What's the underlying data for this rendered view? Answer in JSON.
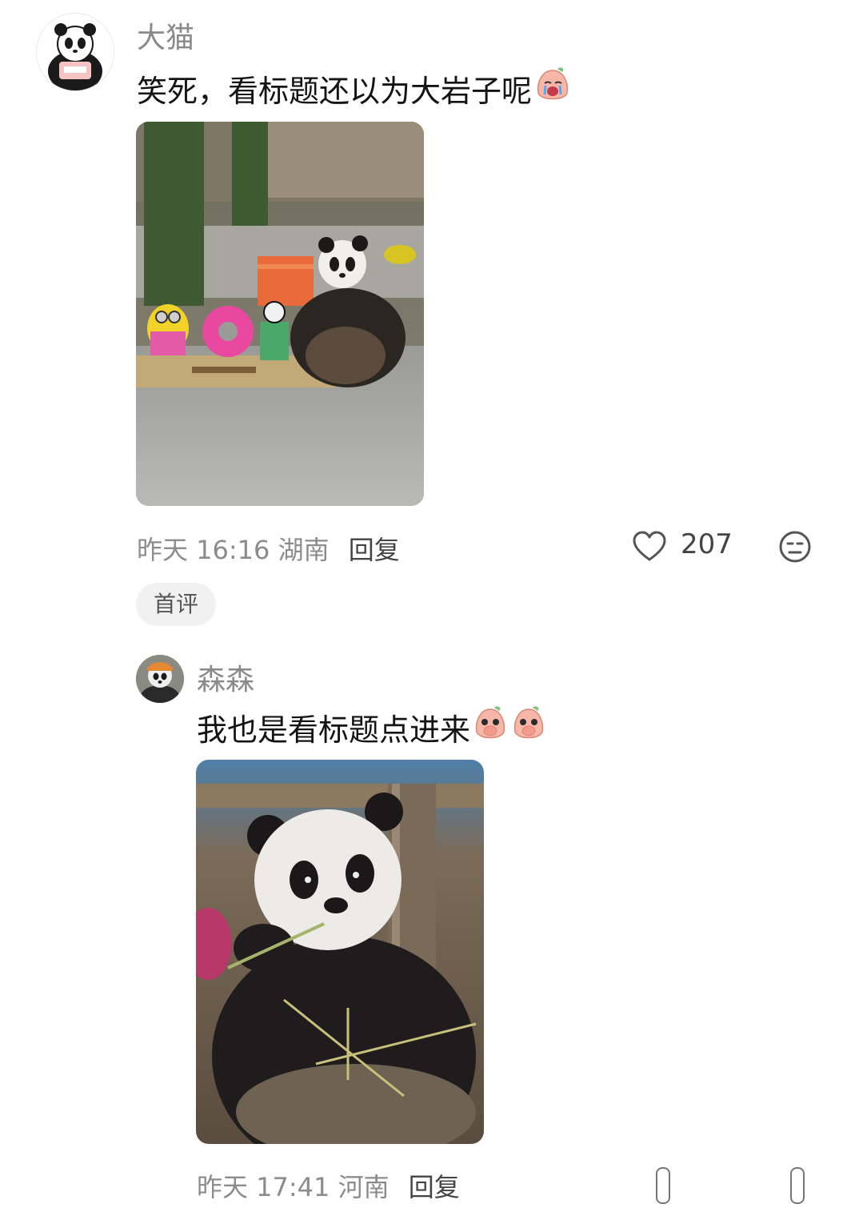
{
  "comments": [
    {
      "username": "大猫",
      "text": "笑死，看标题还以为大岩子呢",
      "emoji": "crying-peach-emoji",
      "time": "昨天 16:16",
      "location": "湖南",
      "reply_label": "回复",
      "likes": "207",
      "badge": "首评"
    },
    {
      "username": "森森",
      "text": "我也是看标题点进来",
      "emoji": "covering-mouth-peach-emoji",
      "time": "昨天 17:41",
      "location": "河南",
      "reply_label": "回复"
    }
  ],
  "colors": {
    "username": "#8a8a8a",
    "meta": "#8c8c8c",
    "badge_bg": "#f1f1f1",
    "emoji_skin": "#f6b6a8"
  }
}
